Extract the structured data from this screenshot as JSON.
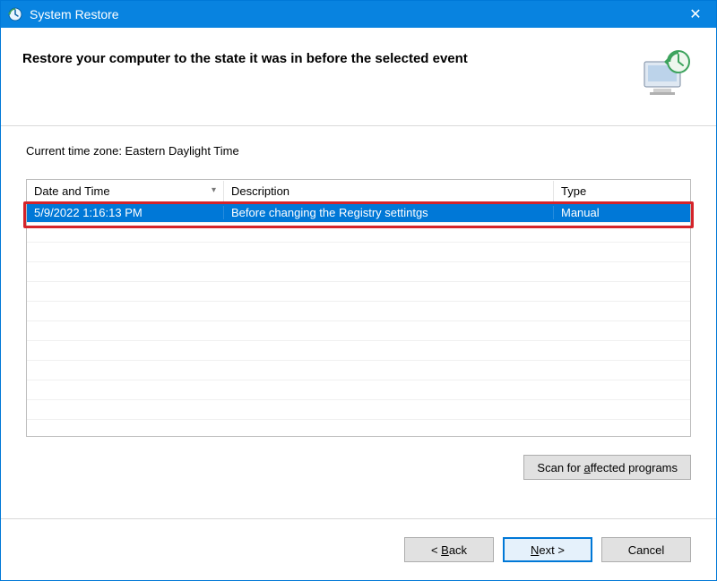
{
  "window": {
    "title": "System Restore",
    "close_label": "✕"
  },
  "header": {
    "heading": "Restore your computer to the state it was in before the selected event"
  },
  "timezone": {
    "label": "Current time zone: Eastern Daylight Time"
  },
  "table": {
    "columns": {
      "date": "Date and Time",
      "description": "Description",
      "type": "Type"
    },
    "rows": [
      {
        "date": "5/9/2022 1:16:13 PM",
        "description": "Before changing the Registry settintgs",
        "type": "Manual",
        "selected": true
      }
    ]
  },
  "buttons": {
    "scan": {
      "pre": "Scan for ",
      "access": "a",
      "post": "ffected programs"
    },
    "back": {
      "pre": "< ",
      "access": "B",
      "post": "ack"
    },
    "next": {
      "pre": "",
      "access": "N",
      "post": "ext >"
    },
    "cancel": "Cancel"
  }
}
